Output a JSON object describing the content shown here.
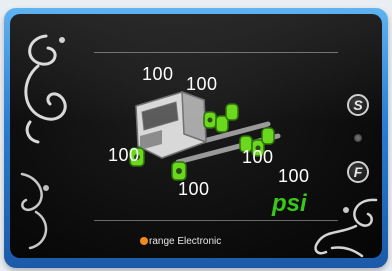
{
  "tire_readings": {
    "top_left": "100",
    "top_right": "100",
    "left": "100",
    "bottom": "100",
    "right_a": "100",
    "right_b": "100"
  },
  "unit": "psi",
  "buttons": {
    "set_label": "S",
    "function_label": "F"
  },
  "brand": {
    "first_letter": "O",
    "rest": "range Electronic"
  },
  "colors": {
    "frame_blue": "#2a7dd1",
    "tire_green": "#6ad81c",
    "unit_green": "#37c81a",
    "brand_orange": "#f28a1a"
  }
}
